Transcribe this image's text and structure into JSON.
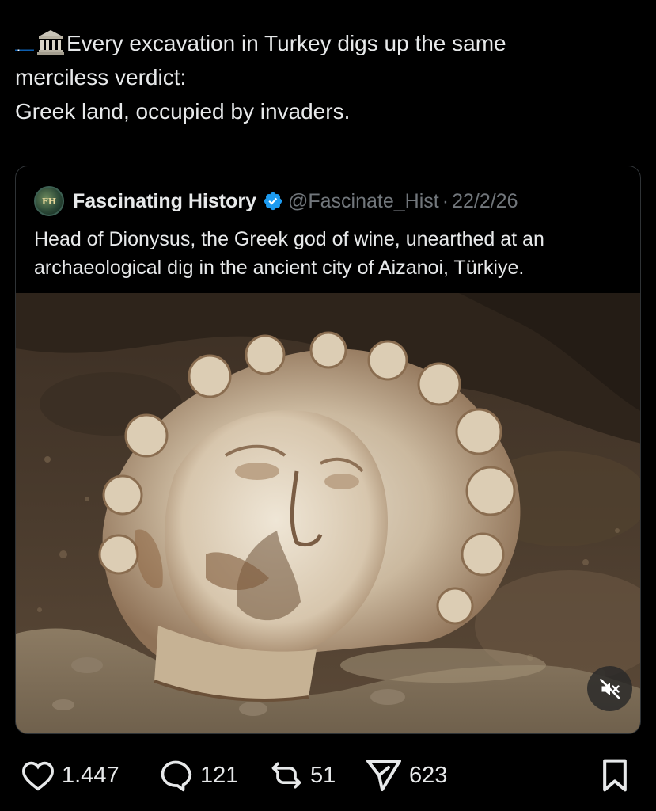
{
  "post": {
    "icons": [
      "greek-flag-icon",
      "classical-building-icon"
    ],
    "text_lines": [
      "Every excavation in Turkey digs up the same",
      "merciless verdict:",
      "Greek land, occupied by invaders."
    ]
  },
  "quoted_post": {
    "avatar_text": "FH",
    "author_name": "Fascinating History",
    "verified": true,
    "handle": "@Fascinate_Hist",
    "separator": "·",
    "date": "22/2/26",
    "text_lines": [
      "Head of Dionysus, the Greek god of wine, unearthed at an",
      "archaeological dig in the ancient city of Aizanoi, Türkiye."
    ],
    "media": {
      "type": "video",
      "muted": true
    }
  },
  "actions": {
    "likes": "1.447",
    "replies": "121",
    "reposts": "51",
    "shares": "623"
  },
  "colors": {
    "background": "#000000",
    "text": "#e7e9ea",
    "secondary_text": "#71767b",
    "border": "#2f3336",
    "verified_blue": "#1d9bf0"
  }
}
